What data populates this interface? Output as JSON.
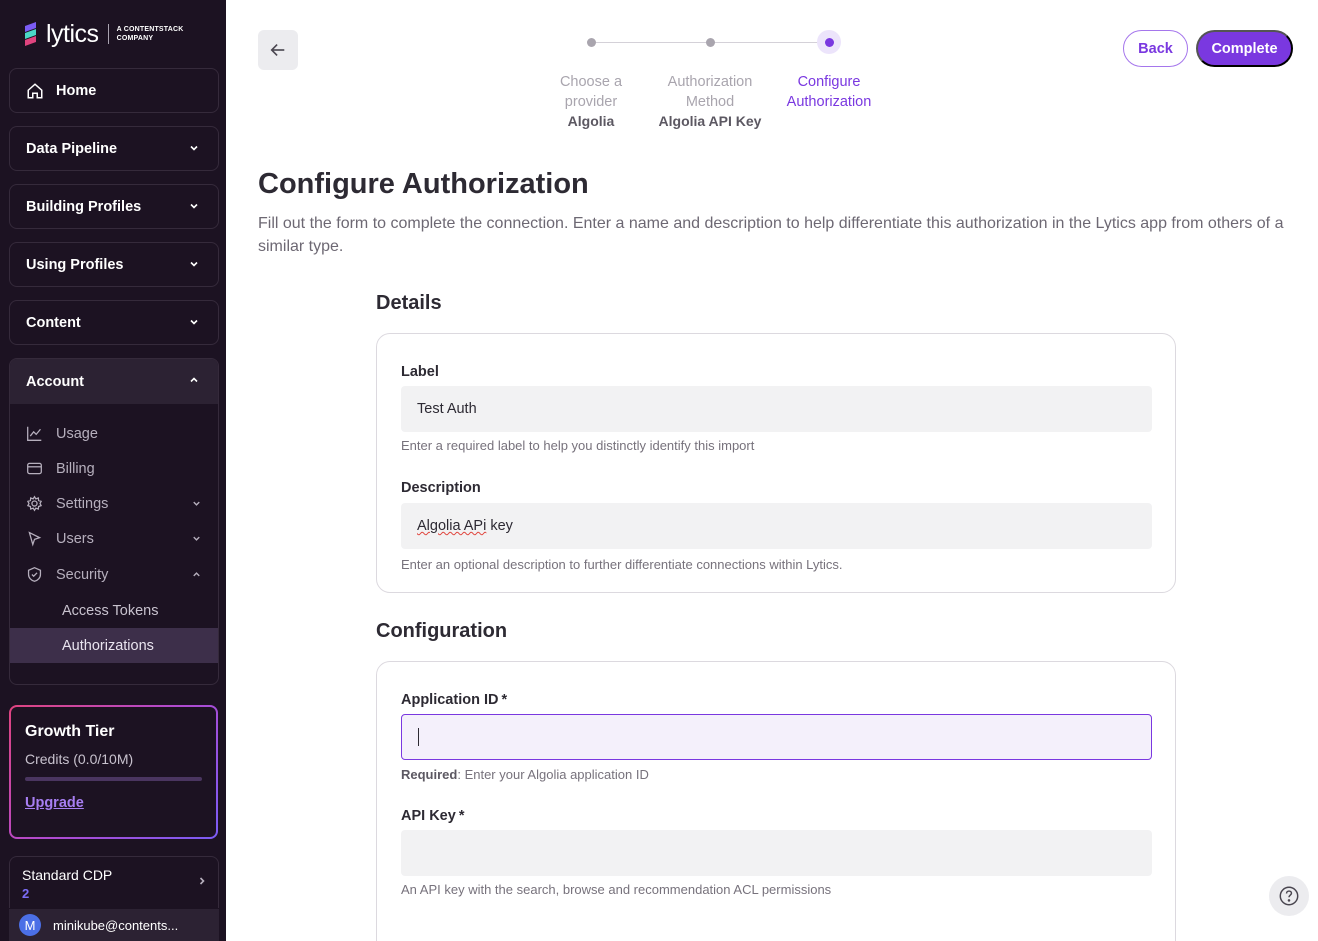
{
  "brand": {
    "name": "lytics",
    "tagline_line1": "A CONTENTSTACK",
    "tagline_line2": "COMPANY",
    "logo_colors": [
      "#7b5cf5",
      "#4ad8c7",
      "#e0447f"
    ]
  },
  "sidebar": {
    "home_label": "Home",
    "sections": [
      {
        "label": "Data Pipeline"
      },
      {
        "label": "Building Profiles"
      },
      {
        "label": "Using Profiles"
      },
      {
        "label": "Content"
      }
    ],
    "account": {
      "label": "Account",
      "items": [
        {
          "label": "Usage",
          "icon": "chart-icon"
        },
        {
          "label": "Billing",
          "icon": "credit-card-icon"
        },
        {
          "label": "Settings",
          "icon": "gear-icon"
        },
        {
          "label": "Users",
          "icon": "cursor-icon"
        },
        {
          "label": "Security",
          "icon": "shield-icon"
        }
      ],
      "security_items": [
        {
          "label": "Access Tokens"
        },
        {
          "label": "Authorizations",
          "active": true
        }
      ]
    },
    "tier": {
      "title": "Growth Tier",
      "credits": "Credits (0.0/10M)",
      "usage_fraction": 0.0,
      "upgrade_label": "Upgrade"
    },
    "plan": {
      "name": "Standard CDP",
      "number": "2"
    },
    "user": {
      "avatar_letter": "M",
      "email": "minikube@contents..."
    }
  },
  "stepper": {
    "steps": [
      {
        "label": "Choose a provider",
        "value": "Algolia",
        "state": "done"
      },
      {
        "label": "Authorization Method",
        "value": "Algolia API Key",
        "state": "done"
      },
      {
        "label": "Configure Authorization",
        "value": "",
        "state": "active"
      }
    ]
  },
  "header": {
    "back_label": "Back",
    "complete_label": "Complete",
    "accent": "#7a38e0"
  },
  "page": {
    "title": "Configure Authorization",
    "description": "Fill out the form to complete the connection. Enter a name and description to help differentiate this authorization in the Lytics app from others of a similar type."
  },
  "details": {
    "title": "Details",
    "label_field": {
      "label": "Label",
      "value": "Test Auth",
      "help": "Enter a required label to help you distinctly identify this import"
    },
    "description_field": {
      "label": "Description",
      "value_part1": "Algolia APi",
      "value_part2": " key",
      "help": "Enter an optional description to further differentiate connections within Lytics."
    }
  },
  "configuration": {
    "title": "Configuration",
    "app_id": {
      "label": "Application ID",
      "required_mark": "*",
      "value": "",
      "help_strong": "Required",
      "help_rest": ": Enter your Algolia application ID"
    },
    "api_key": {
      "label": "API Key",
      "required_mark": "*",
      "value": "",
      "help": "An API key with the search, browse and recommendation ACL permissions"
    }
  }
}
